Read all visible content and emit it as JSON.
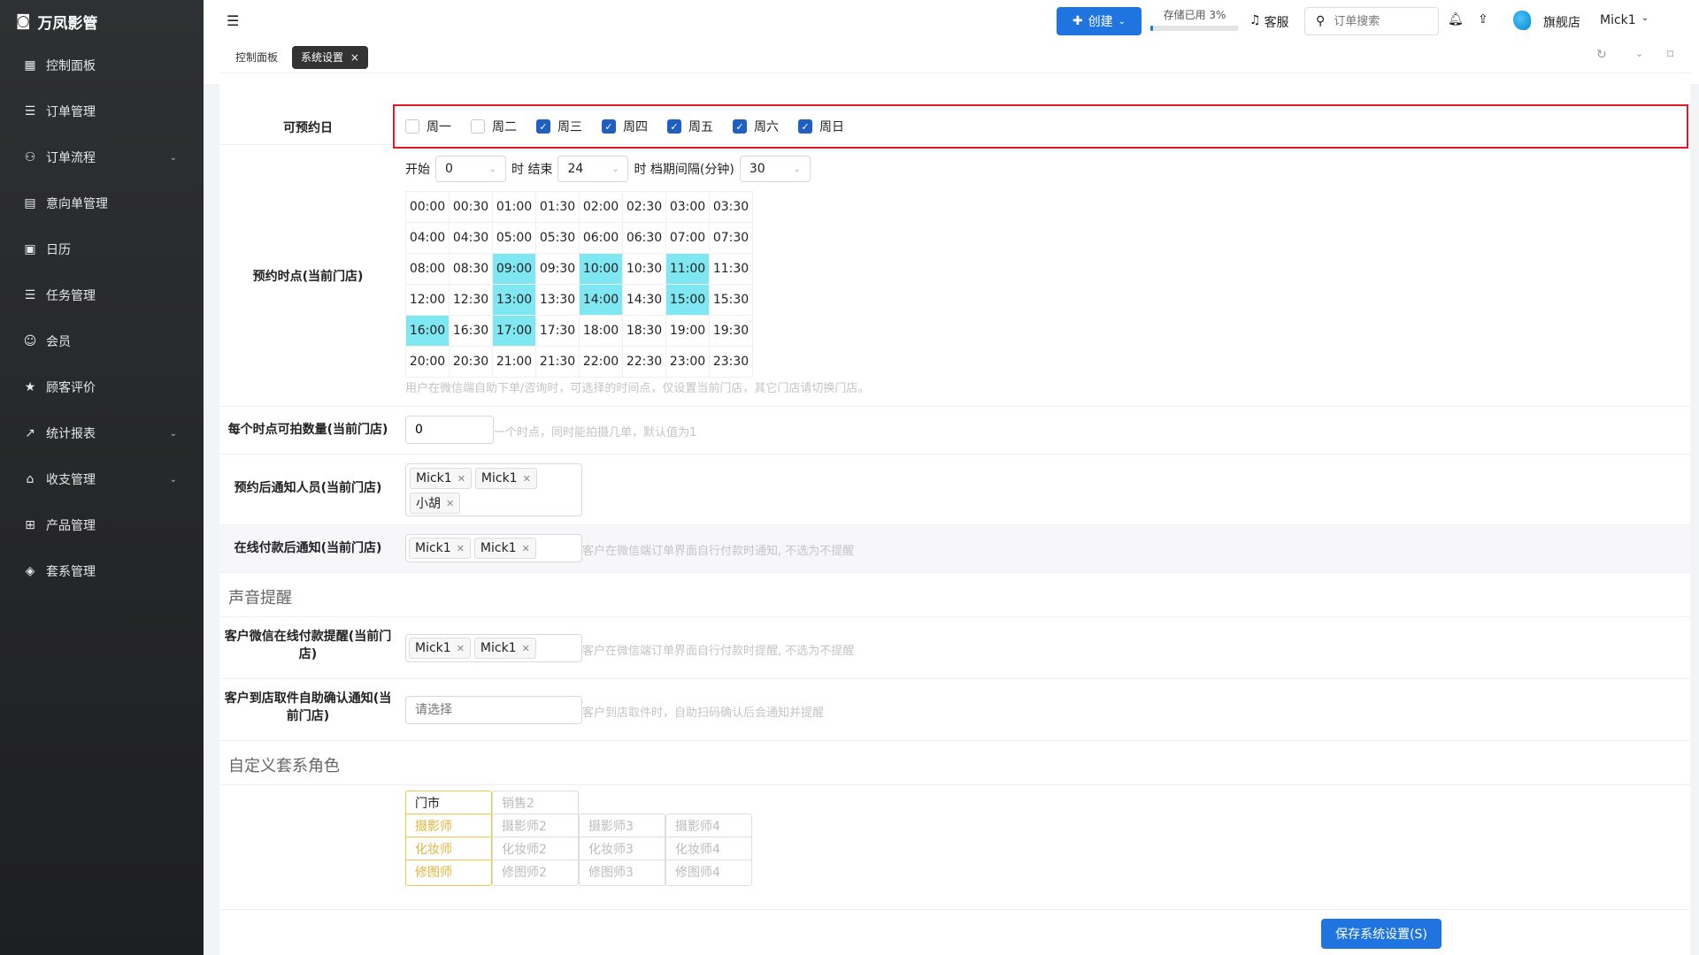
{
  "app": {
    "name": "万凤影管"
  },
  "sidebar": {
    "items": [
      {
        "label": "控制面板",
        "icon": "dashboard-icon",
        "expand": false
      },
      {
        "label": "订单管理",
        "icon": "list-icon",
        "expand": false
      },
      {
        "label": "订单流程",
        "icon": "flow-icon",
        "expand": true
      },
      {
        "label": "意向单管理",
        "icon": "clipboard-icon",
        "expand": false
      },
      {
        "label": "日历",
        "icon": "calendar-icon",
        "expand": false
      },
      {
        "label": "任务管理",
        "icon": "list-icon",
        "expand": false
      },
      {
        "label": "会员",
        "icon": "user-icon",
        "expand": false
      },
      {
        "label": "顾客评价",
        "icon": "star-icon",
        "expand": false
      },
      {
        "label": "统计报表",
        "icon": "chart-icon",
        "expand": true
      },
      {
        "label": "收支管理",
        "icon": "bank-icon",
        "expand": true
      },
      {
        "label": "产品管理",
        "icon": "grid-icon",
        "expand": false
      },
      {
        "label": "套系管理",
        "icon": "package-icon",
        "expand": false
      }
    ]
  },
  "topbar": {
    "create": "创建",
    "storage": "存储已用 3%",
    "storage_pct": 3,
    "service": "客服",
    "search_placeholder": "订单搜索",
    "store": "旗舰店",
    "user": "Mick1"
  },
  "tabs": [
    {
      "label": "控制面板",
      "active": false
    },
    {
      "label": "系统设置",
      "active": true
    }
  ],
  "form": {
    "days_label": "可预约日",
    "days": [
      {
        "label": "周一",
        "checked": false
      },
      {
        "label": "周二",
        "checked": false
      },
      {
        "label": "周三",
        "checked": true
      },
      {
        "label": "周四",
        "checked": true
      },
      {
        "label": "周五",
        "checked": true
      },
      {
        "label": "周六",
        "checked": true
      },
      {
        "label": "周日",
        "checked": true
      }
    ],
    "time_label": "预约时点(当前门店)",
    "start_label": "开始",
    "start_val": "0",
    "end_label": "时 结束",
    "end_val": "24",
    "interval_label": "时 档期间隔(分钟)",
    "interval_val": "30",
    "slots": [
      [
        "00:00",
        "00:30",
        "01:00",
        "01:30",
        "02:00",
        "02:30",
        "03:00",
        "03:30"
      ],
      [
        "04:00",
        "04:30",
        "05:00",
        "05:30",
        "06:00",
        "06:30",
        "07:00",
        "07:30"
      ],
      [
        "08:00",
        "08:30",
        "09:00",
        "09:30",
        "10:00",
        "10:30",
        "11:00",
        "11:30"
      ],
      [
        "12:00",
        "12:30",
        "13:00",
        "13:30",
        "14:00",
        "14:30",
        "15:00",
        "15:30"
      ],
      [
        "16:00",
        "16:30",
        "17:00",
        "17:30",
        "18:00",
        "18:30",
        "19:00",
        "19:30"
      ],
      [
        "20:00",
        "20:30",
        "21:00",
        "21:30",
        "22:00",
        "22:30",
        "23:00",
        "23:30"
      ]
    ],
    "selected_slots": [
      "09:00",
      "10:00",
      "11:00",
      "13:00",
      "14:00",
      "15:00",
      "16:00",
      "17:00"
    ],
    "time_hint": "用户在微信端自助下单/咨询时，可选择的时间点，仅设置当前门店，其它门店请切换门店。",
    "count_label": "每个时点可拍数量(当前门店)",
    "count_val": "0",
    "count_hint": "一个时点，同时能拍摄几单，默认值为1",
    "notify_label": "预约后通知人员(当前门店)",
    "notify_tags": [
      "Mick1",
      "Mick1",
      "小胡"
    ],
    "pay_label": "在线付款后通知(当前门店)",
    "pay_tags": [
      "Mick1",
      "Mick1"
    ],
    "pay_hint": "客户在微信端订单界面自行付款时通知, 不选为不提醒",
    "sound_section": "声音提醒",
    "wx_label": "客户微信在线付款提醒(当前门店)",
    "wx_tags": [
      "Mick1",
      "Mick1"
    ],
    "wx_hint": "客户在微信端订单界面自行付款时提醒, 不选为不提醒",
    "pickup_label": "客户到店取件自助确认通知(当前门店)",
    "pickup_placeholder": "请选择",
    "pickup_hint": "客户到店取件时，自助扫码确认后会通知并提醒",
    "role_section": "自定义套系角色",
    "roles": [
      [
        "门市",
        "销售2"
      ],
      [
        "摄影师",
        "摄影师2",
        "摄影师3",
        "摄影师4"
      ],
      [
        "化妆师",
        "化妆师2",
        "化妆师3",
        "化妆师4"
      ],
      [
        "修图师",
        "修图师2",
        "修图师3",
        "修图师4"
      ]
    ]
  },
  "save_label": "保存系统设置(S)",
  "colors": {
    "primary": "#1f74e0",
    "highlight": "#7fe7f2",
    "focus": "#e11b22"
  }
}
